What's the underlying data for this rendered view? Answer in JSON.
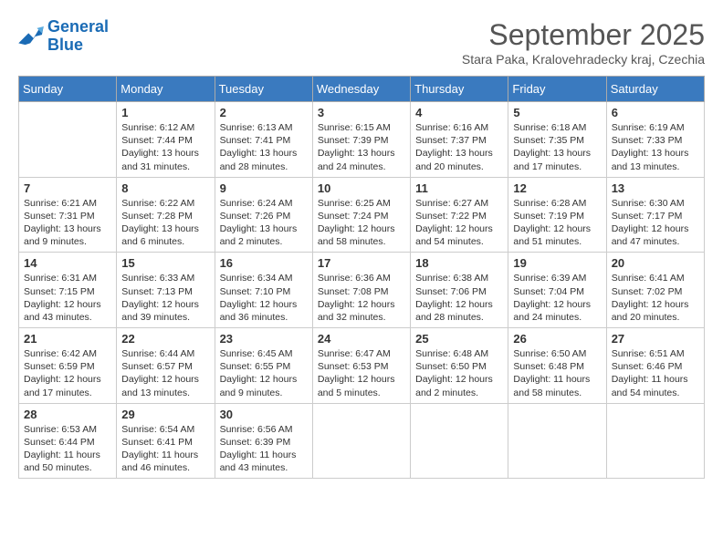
{
  "logo": {
    "line1": "General",
    "line2": "Blue"
  },
  "title": "September 2025",
  "subtitle": "Stara Paka, Kralovehradecky kraj, Czechia",
  "headers": [
    "Sunday",
    "Monday",
    "Tuesday",
    "Wednesday",
    "Thursday",
    "Friday",
    "Saturday"
  ],
  "weeks": [
    [
      {
        "day": "",
        "info": ""
      },
      {
        "day": "1",
        "info": "Sunrise: 6:12 AM\nSunset: 7:44 PM\nDaylight: 13 hours\nand 31 minutes."
      },
      {
        "day": "2",
        "info": "Sunrise: 6:13 AM\nSunset: 7:41 PM\nDaylight: 13 hours\nand 28 minutes."
      },
      {
        "day": "3",
        "info": "Sunrise: 6:15 AM\nSunset: 7:39 PM\nDaylight: 13 hours\nand 24 minutes."
      },
      {
        "day": "4",
        "info": "Sunrise: 6:16 AM\nSunset: 7:37 PM\nDaylight: 13 hours\nand 20 minutes."
      },
      {
        "day": "5",
        "info": "Sunrise: 6:18 AM\nSunset: 7:35 PM\nDaylight: 13 hours\nand 17 minutes."
      },
      {
        "day": "6",
        "info": "Sunrise: 6:19 AM\nSunset: 7:33 PM\nDaylight: 13 hours\nand 13 minutes."
      }
    ],
    [
      {
        "day": "7",
        "info": "Sunrise: 6:21 AM\nSunset: 7:31 PM\nDaylight: 13 hours\nand 9 minutes."
      },
      {
        "day": "8",
        "info": "Sunrise: 6:22 AM\nSunset: 7:28 PM\nDaylight: 13 hours\nand 6 minutes."
      },
      {
        "day": "9",
        "info": "Sunrise: 6:24 AM\nSunset: 7:26 PM\nDaylight: 13 hours\nand 2 minutes."
      },
      {
        "day": "10",
        "info": "Sunrise: 6:25 AM\nSunset: 7:24 PM\nDaylight: 12 hours\nand 58 minutes."
      },
      {
        "day": "11",
        "info": "Sunrise: 6:27 AM\nSunset: 7:22 PM\nDaylight: 12 hours\nand 54 minutes."
      },
      {
        "day": "12",
        "info": "Sunrise: 6:28 AM\nSunset: 7:19 PM\nDaylight: 12 hours\nand 51 minutes."
      },
      {
        "day": "13",
        "info": "Sunrise: 6:30 AM\nSunset: 7:17 PM\nDaylight: 12 hours\nand 47 minutes."
      }
    ],
    [
      {
        "day": "14",
        "info": "Sunrise: 6:31 AM\nSunset: 7:15 PM\nDaylight: 12 hours\nand 43 minutes."
      },
      {
        "day": "15",
        "info": "Sunrise: 6:33 AM\nSunset: 7:13 PM\nDaylight: 12 hours\nand 39 minutes."
      },
      {
        "day": "16",
        "info": "Sunrise: 6:34 AM\nSunset: 7:10 PM\nDaylight: 12 hours\nand 36 minutes."
      },
      {
        "day": "17",
        "info": "Sunrise: 6:36 AM\nSunset: 7:08 PM\nDaylight: 12 hours\nand 32 minutes."
      },
      {
        "day": "18",
        "info": "Sunrise: 6:38 AM\nSunset: 7:06 PM\nDaylight: 12 hours\nand 28 minutes."
      },
      {
        "day": "19",
        "info": "Sunrise: 6:39 AM\nSunset: 7:04 PM\nDaylight: 12 hours\nand 24 minutes."
      },
      {
        "day": "20",
        "info": "Sunrise: 6:41 AM\nSunset: 7:02 PM\nDaylight: 12 hours\nand 20 minutes."
      }
    ],
    [
      {
        "day": "21",
        "info": "Sunrise: 6:42 AM\nSunset: 6:59 PM\nDaylight: 12 hours\nand 17 minutes."
      },
      {
        "day": "22",
        "info": "Sunrise: 6:44 AM\nSunset: 6:57 PM\nDaylight: 12 hours\nand 13 minutes."
      },
      {
        "day": "23",
        "info": "Sunrise: 6:45 AM\nSunset: 6:55 PM\nDaylight: 12 hours\nand 9 minutes."
      },
      {
        "day": "24",
        "info": "Sunrise: 6:47 AM\nSunset: 6:53 PM\nDaylight: 12 hours\nand 5 minutes."
      },
      {
        "day": "25",
        "info": "Sunrise: 6:48 AM\nSunset: 6:50 PM\nDaylight: 12 hours\nand 2 minutes."
      },
      {
        "day": "26",
        "info": "Sunrise: 6:50 AM\nSunset: 6:48 PM\nDaylight: 11 hours\nand 58 minutes."
      },
      {
        "day": "27",
        "info": "Sunrise: 6:51 AM\nSunset: 6:46 PM\nDaylight: 11 hours\nand 54 minutes."
      }
    ],
    [
      {
        "day": "28",
        "info": "Sunrise: 6:53 AM\nSunset: 6:44 PM\nDaylight: 11 hours\nand 50 minutes."
      },
      {
        "day": "29",
        "info": "Sunrise: 6:54 AM\nSunset: 6:41 PM\nDaylight: 11 hours\nand 46 minutes."
      },
      {
        "day": "30",
        "info": "Sunrise: 6:56 AM\nSunset: 6:39 PM\nDaylight: 11 hours\nand 43 minutes."
      },
      {
        "day": "",
        "info": ""
      },
      {
        "day": "",
        "info": ""
      },
      {
        "day": "",
        "info": ""
      },
      {
        "day": "",
        "info": ""
      }
    ]
  ]
}
